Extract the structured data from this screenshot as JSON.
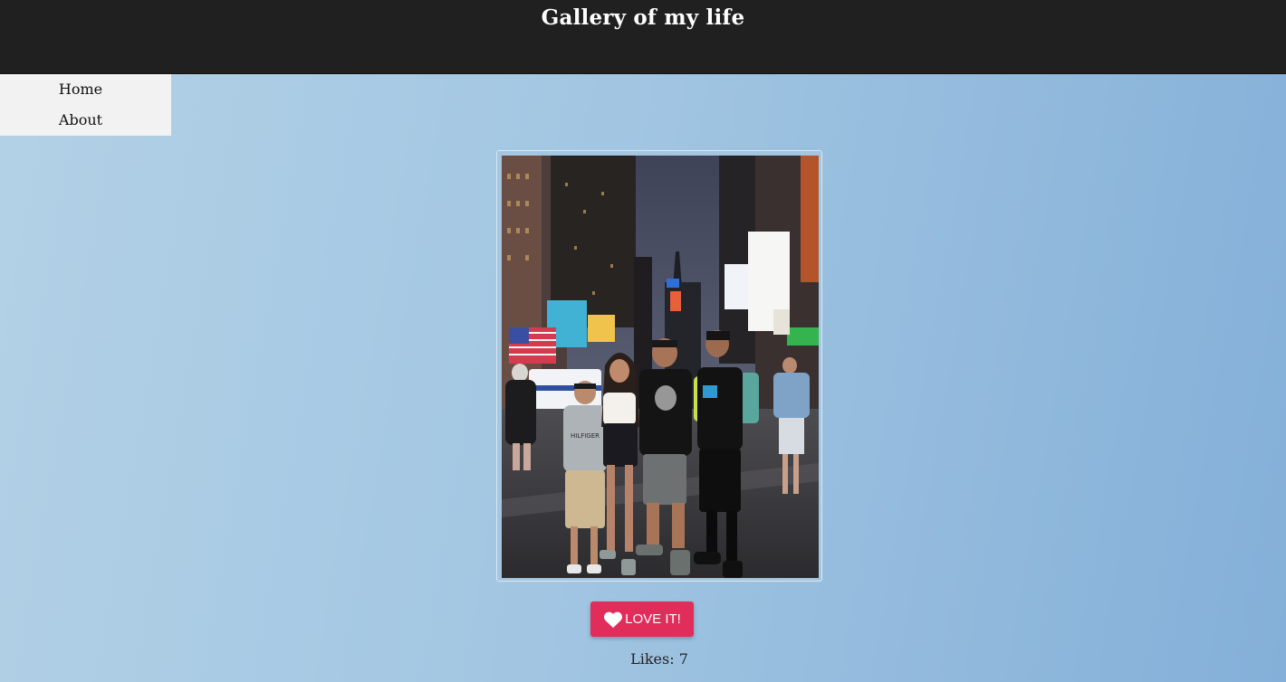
{
  "header": {
    "title": "Gallery of my life"
  },
  "nav": {
    "items": [
      {
        "label": "Home"
      },
      {
        "label": "About"
      }
    ]
  },
  "photo": {
    "description_icon": "photo-image"
  },
  "love_button": {
    "label": "LOVE IT!",
    "icon": "heart-icon",
    "color": "#e12d5a"
  },
  "likes": {
    "text": "Likes: 7"
  },
  "colors": {
    "header_bg": "#202020",
    "nav_bg": "#f2f2f2"
  }
}
